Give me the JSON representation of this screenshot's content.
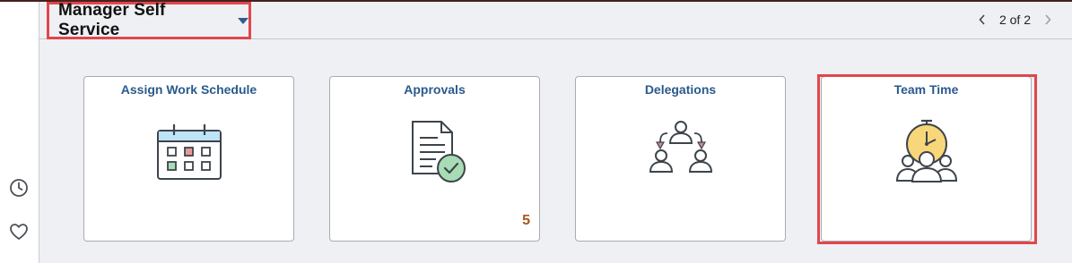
{
  "header": {
    "title": "Manager Self Service",
    "page_indicator": "2 of 2",
    "prev_icon": "chevron-left-icon",
    "next_icon": "chevron-right-icon"
  },
  "left_rail": {
    "icons": [
      "recent-history-icon",
      "favorites-heart-icon"
    ]
  },
  "tiles": [
    {
      "title": "Assign Work Schedule",
      "icon": "calendar-icon",
      "badge": ""
    },
    {
      "title": "Approvals",
      "icon": "document-check-icon",
      "badge": "5"
    },
    {
      "title": "Delegations",
      "icon": "delegation-people-icon",
      "badge": ""
    },
    {
      "title": "Team Time",
      "icon": "team-clock-icon",
      "badge": ""
    }
  ],
  "colors": {
    "highlight": "#e0474c",
    "tile_title": "#2a5a8c",
    "badge": "#a8551c",
    "clock_face": "#f7d77a",
    "check_green": "#a8dcb4"
  }
}
